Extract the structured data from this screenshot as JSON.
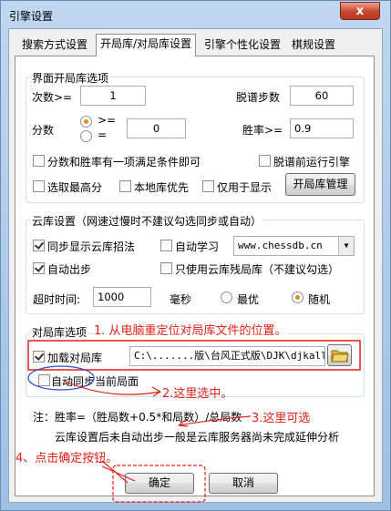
{
  "window": {
    "title": "引擎设置",
    "close_glyph": "x"
  },
  "tabs": [
    "搜索方式设置",
    "开局库/对局库设置",
    "引擎个性化设置",
    "棋规设置"
  ],
  "interface_group": {
    "legend": "界面开局库选项",
    "move_count_label": "次数>=",
    "move_count_value": "1",
    "off_book_steps_label": "脱谱步数",
    "off_book_steps_value": "60",
    "score_label": "分数",
    "radio_ge": ">=",
    "radio_eq": "=",
    "score_value": "0",
    "win_rate_label": "胜率>=",
    "win_rate_value": "0.9",
    "either_condition_label": "分数和胜率有一项满足条件即可",
    "run_engine_before_off_book_label": "脱谱前运行引擎",
    "select_highest_label": "选取最高分",
    "local_library_first_label": "本地库优先",
    "display_only_label": "仅用于显示",
    "manage_button": "开局库管理"
  },
  "cloud_group": {
    "legend": "云库设置（网速过慢时不建议勾选同步或自动）",
    "sync_moves_label": "同步显示云库招法",
    "auto_learn_label": "自动学习",
    "server_value": "www.chessdb.cn",
    "auto_move_label": "自动出步",
    "cloud_endgame_only_label": "只使用云库残局库（不建议勾选）",
    "timeout_label": "超时时间:",
    "timeout_value": "1000",
    "ms_label": "毫秒",
    "best_label": "最优",
    "random_label": "随机"
  },
  "game_library_group": {
    "legend": "对局库选项",
    "load_library_label": "加载对局库",
    "library_path": "C:\\.......版\\台风正式版\\DJK\\djkall.d",
    "auto_sync_label": "自动同步当前局面"
  },
  "notes": {
    "formula": "注：胜率=（胜局数+0.5*和局数）/总局数",
    "cloud_note": "云库设置后未自动出步一般是云库服务器尚未完成延伸分析"
  },
  "buttons": {
    "ok": "确定",
    "cancel": "取消"
  },
  "annotations": {
    "step1": "1. 从电脑重定位对局库文件的位置。",
    "step2": "2.这里选中。",
    "step3": "3.这里可选",
    "step4": "4、点击确定按钮。"
  },
  "colors": {
    "annotation": "#e0201a",
    "circle": "#2a4fc0",
    "titlebar": "#bfd7ef"
  }
}
